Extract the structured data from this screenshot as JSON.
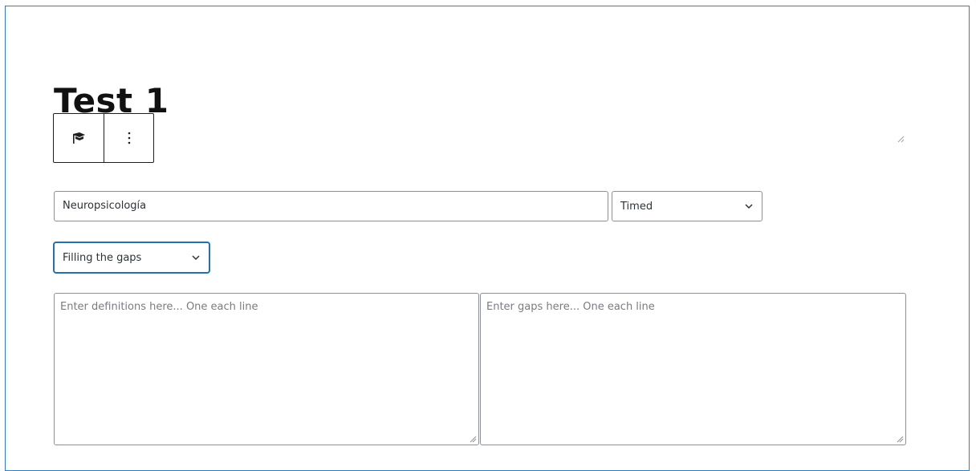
{
  "block": {
    "title": "Test 1",
    "toolbar": {
      "block_icon": "graduation-cap-icon",
      "options_icon": "more-vertical-icon"
    }
  },
  "form": {
    "name_value": "Neuropsicología",
    "mode_select": {
      "selected": "Timed"
    },
    "type_select": {
      "selected": "Filling the gaps"
    },
    "definitions_placeholder": "Enter definitions here... One each line",
    "gaps_placeholder": "Enter gaps here... One each line"
  },
  "colors": {
    "frame_border": "#2f80c0",
    "focus_accent": "#2271b1",
    "field_border": "#8c8f94",
    "title_text": "#111111"
  }
}
